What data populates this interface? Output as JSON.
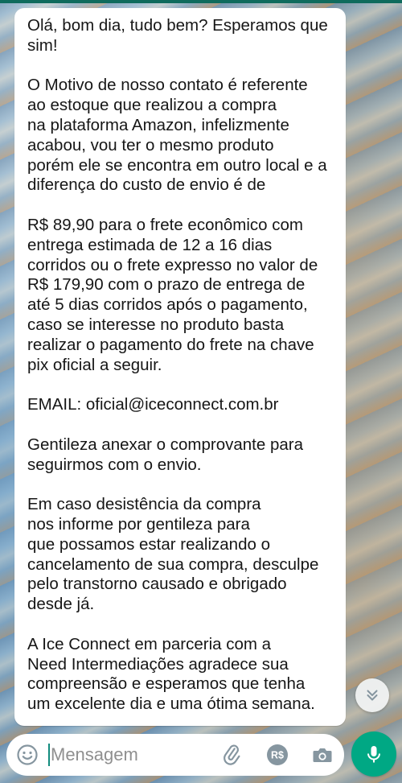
{
  "message": {
    "paragraphs": [
      "Olá, bom dia, tudo bem? Esperamos que\nsim!",
      "O Motivo de nosso contato é referente\nao estoque que realizou a compra\nna plataforma Amazon, infelizmente\nacabou, vou ter o mesmo produto\nporém ele se encontra em outro local e a\ndiferença do custo de envio é de",
      "R$ 89,90 para o frete econômico com\nentrega estimada de 12 a 16 dias\ncorridos ou o frete expresso no valor de\nR$ 179,90 com o prazo de entrega de\naté 5 dias corridos após o pagamento,\ncaso se interesse no produto basta\nrealizar o pagamento do frete na chave\npix oficial a seguir.",
      "EMAIL: oficial@iceconnect.com.br",
      "Gentileza anexar o comprovante para\nseguirmos com o envio.",
      "Em caso desistência da compra\nnos informe por gentileza para\nque possamos estar realizando o\ncancelamento de sua compra, desculpe\npelo transtorno causado e obrigado\ndesde já.",
      "A Ice Connect em parceria com a\nNeed Intermediações agradece sua\ncompreensão e esperamos que tenha\num excelente dia e uma ótima semana."
    ]
  },
  "composer": {
    "placeholder": "Mensagem",
    "payment_icon_text": "R$"
  },
  "icons": {
    "emoji": "emoji-icon",
    "attach": "paperclip-icon",
    "payment": "payment-icon",
    "camera": "camera-icon",
    "mic": "microphone-icon",
    "scroll_down": "double-chevron-down-icon"
  },
  "colors": {
    "header": "#0f6b5d",
    "accent": "#00a884",
    "icon_gray": "#8696a0"
  }
}
